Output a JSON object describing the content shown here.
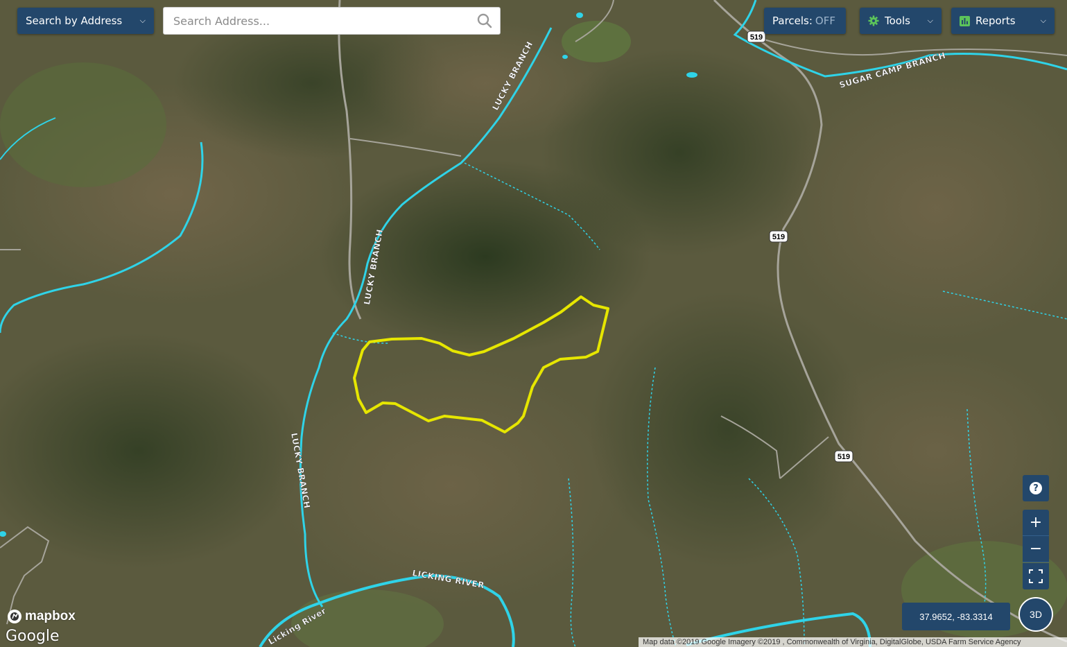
{
  "toolbar": {
    "search_mode_label": "Search by Address",
    "search_placeholder": "Search Address...",
    "parcels_label": "Parcels:",
    "parcels_state": "OFF",
    "tools_label": "Tools",
    "reports_label": "Reports"
  },
  "map": {
    "labels": {
      "lucky_branch_north": "LUCKY BRANCH",
      "lucky_branch_mid": "LUCKY BRANCH",
      "lucky_branch_south": "LUCKY BRANCH",
      "sugar_camp_branch": "SUGAR CAMP BRANCH",
      "licking_river": "LICKING RIVER",
      "licking_river_low": "Licking River"
    },
    "route_shields": [
      "519",
      "519",
      "519"
    ],
    "parcel_outline_color": "#e6e600",
    "stream_color": "#2fd3e8"
  },
  "controls": {
    "help_label": "?",
    "zoom_in_label": "+",
    "zoom_out_label": "−",
    "three_d_label": "3D",
    "coords": "37.9652, -83.3314"
  },
  "branding": {
    "mapbox": "mapbox",
    "google": "Google",
    "attribution": "Map data ©2019 Google Imagery ©2019 , Commonwealth of Virginia, DigitalGlobe, USDA Farm Service Agency"
  },
  "colors": {
    "button_bg": "#23476b",
    "terrain": "#4a5637"
  }
}
